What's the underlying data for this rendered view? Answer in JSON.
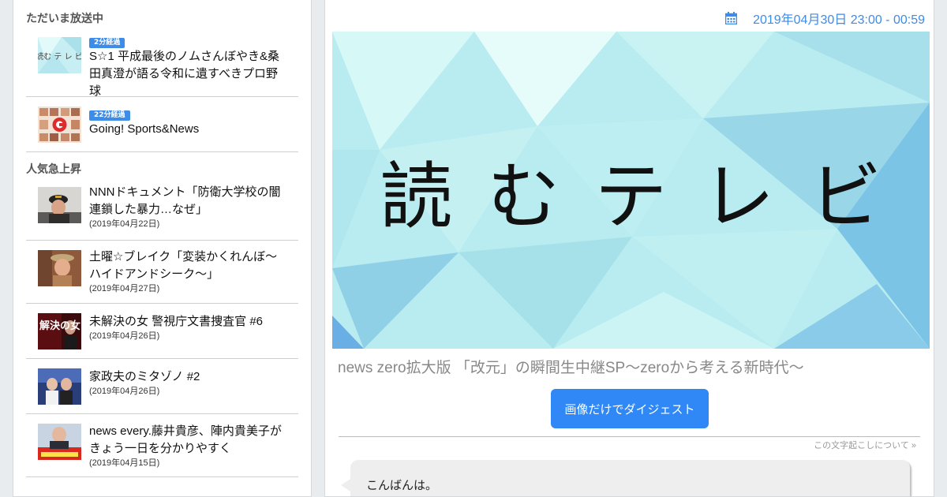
{
  "sidebar": {
    "now_on_air": {
      "title": "ただいま放送中",
      "items": [
        {
          "badge": "2分経過",
          "title": "S☆1 平成最後のノムさんぼやき&桑田真澄が語る令和に遺すべきプロ野球",
          "thumb": "yomu-tv-logo-thumb"
        },
        {
          "badge": "22分経過",
          "title": "Going! Sports&News",
          "thumb": "going-program-thumb"
        }
      ]
    },
    "trending": {
      "title": "人気急上昇",
      "items": [
        {
          "title": "NNNドキュメント「防衛大学校の闇 連鎖した暴力…なぜ」",
          "date": "(2019年04月22日)"
        },
        {
          "title": "土曜☆ブレイク「変装かくれんぼ～ハイドアンドシーク～」",
          "date": "(2019年04月27日)"
        },
        {
          "title": "未解決の女 警視庁文書捜査官 #6",
          "date": "(2019年04月26日)",
          "thumb_text": "解決の女"
        },
        {
          "title": "家政夫のミタゾノ #2",
          "date": "(2019年04月26日)"
        },
        {
          "title": "news every.藤井貴彦、陣内貴美子がきょう一日を分かりやすく",
          "date": "(2019年04月15日)"
        }
      ]
    }
  },
  "main": {
    "airtime": "2019年04月30日 23:00 - 00:59",
    "hero_logo_chars": [
      "読",
      "む",
      "テ",
      "レ",
      "ビ"
    ],
    "program_title": "news zero拡大版 「改元」の瞬間生中継SP～zeroから考える新時代～",
    "digest_button": "画像だけでダイジェスト",
    "about_link": "この文字起こしについて »",
    "transcript_first": "こんばんは。"
  },
  "colors": {
    "accent": "#3c8ce8",
    "button": "#2f88f5",
    "hero_light": "#d8f6f7",
    "hero_mid": "#9fdfea",
    "hero_dark": "#6bbfe8"
  }
}
